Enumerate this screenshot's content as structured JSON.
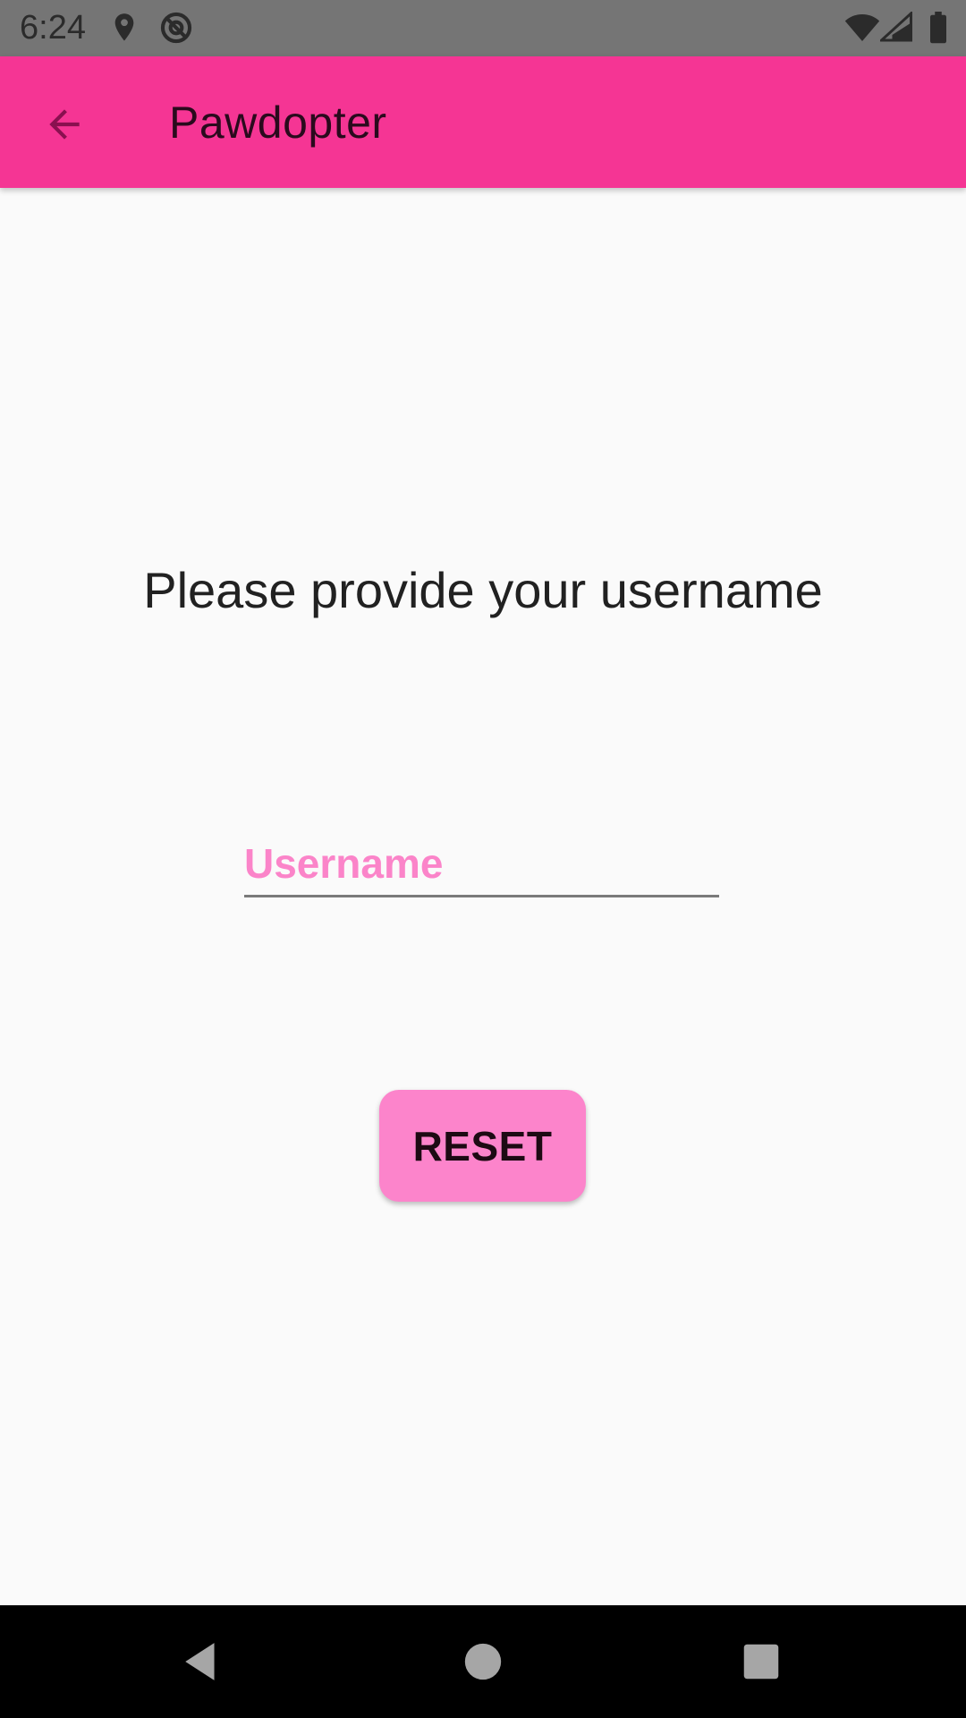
{
  "status_bar": {
    "time": "6:24",
    "icons": [
      "location-icon",
      "at-sign-icon",
      "wifi-icon",
      "cellular-signal-icon",
      "battery-icon"
    ]
  },
  "app_bar": {
    "title": "Pawdopter",
    "back_icon": "arrow-back-icon",
    "background_color": "#f53594"
  },
  "main": {
    "prompt": "Please provide your username",
    "username_field": {
      "placeholder": "Username",
      "value": ""
    },
    "reset_button": {
      "label": "RESET",
      "color": "#fc84cb"
    }
  },
  "nav_bar": {
    "buttons": [
      "back-triangle-icon",
      "home-circle-icon",
      "recents-square-icon"
    ]
  },
  "colors": {
    "accent": "#f53594",
    "accent_light": "#fc84cb",
    "background": "#fafafa",
    "status_bar": "#757575"
  }
}
